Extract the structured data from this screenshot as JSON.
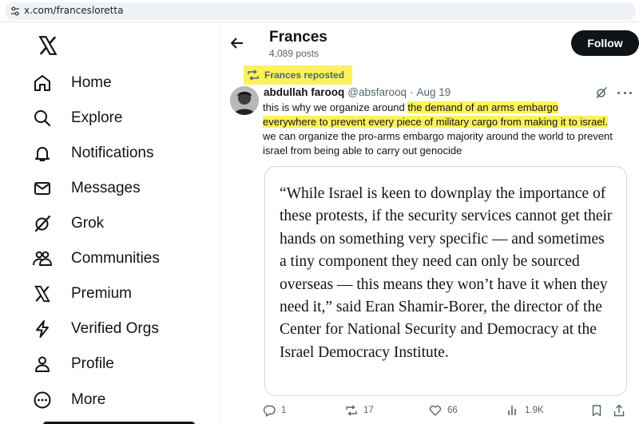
{
  "browser": {
    "url": "x.com/francesloretta"
  },
  "sidebar": {
    "items": [
      {
        "label": "Home",
        "icon": "home-icon"
      },
      {
        "label": "Explore",
        "icon": "search-icon"
      },
      {
        "label": "Notifications",
        "icon": "bell-icon"
      },
      {
        "label": "Messages",
        "icon": "envelope-icon"
      },
      {
        "label": "Grok",
        "icon": "grok-icon"
      },
      {
        "label": "Communities",
        "icon": "communities-icon"
      },
      {
        "label": "Premium",
        "icon": "x-logo-icon"
      },
      {
        "label": "Verified Orgs",
        "icon": "lightning-icon"
      },
      {
        "label": "Profile",
        "icon": "person-icon"
      },
      {
        "label": "More",
        "icon": "more-circle-icon"
      }
    ]
  },
  "header": {
    "title": "Frances",
    "post_count": "4,089 posts",
    "follow_label": "Follow"
  },
  "tweet": {
    "repost_label": "Frances reposted",
    "author_name": "abdullah farooq",
    "author_handle": "@absfarooq",
    "separator": "·",
    "date": "Aug 19",
    "text_1": "this is why we organize around ",
    "text_hl_1": "the demand of an arms embargo",
    "text_hl_2": "everywhere to prevent every piece of military cargo from making it to israel.",
    "text_2": "we can organize the pro-arms embargo majority around the world to prevent israel from being able to carry out genocide",
    "quote": "“While Israel is keen to downplay the importance of these protests, if the security services cannot get their hands on something very specific — and sometimes a tiny component they need can only be sourced overseas — this means they won’t have it when they need it,” said Eran Shamir-Borer, the director of the Center for National Security and Democracy at the Israel Democracy Institute.",
    "replies": "1",
    "reposts": "17",
    "likes": "66",
    "views": "1.9K"
  },
  "colors": {
    "highlight": "#fdf25a",
    "text": "#0f1419",
    "muted": "#536471",
    "border": "#cfd9de"
  }
}
